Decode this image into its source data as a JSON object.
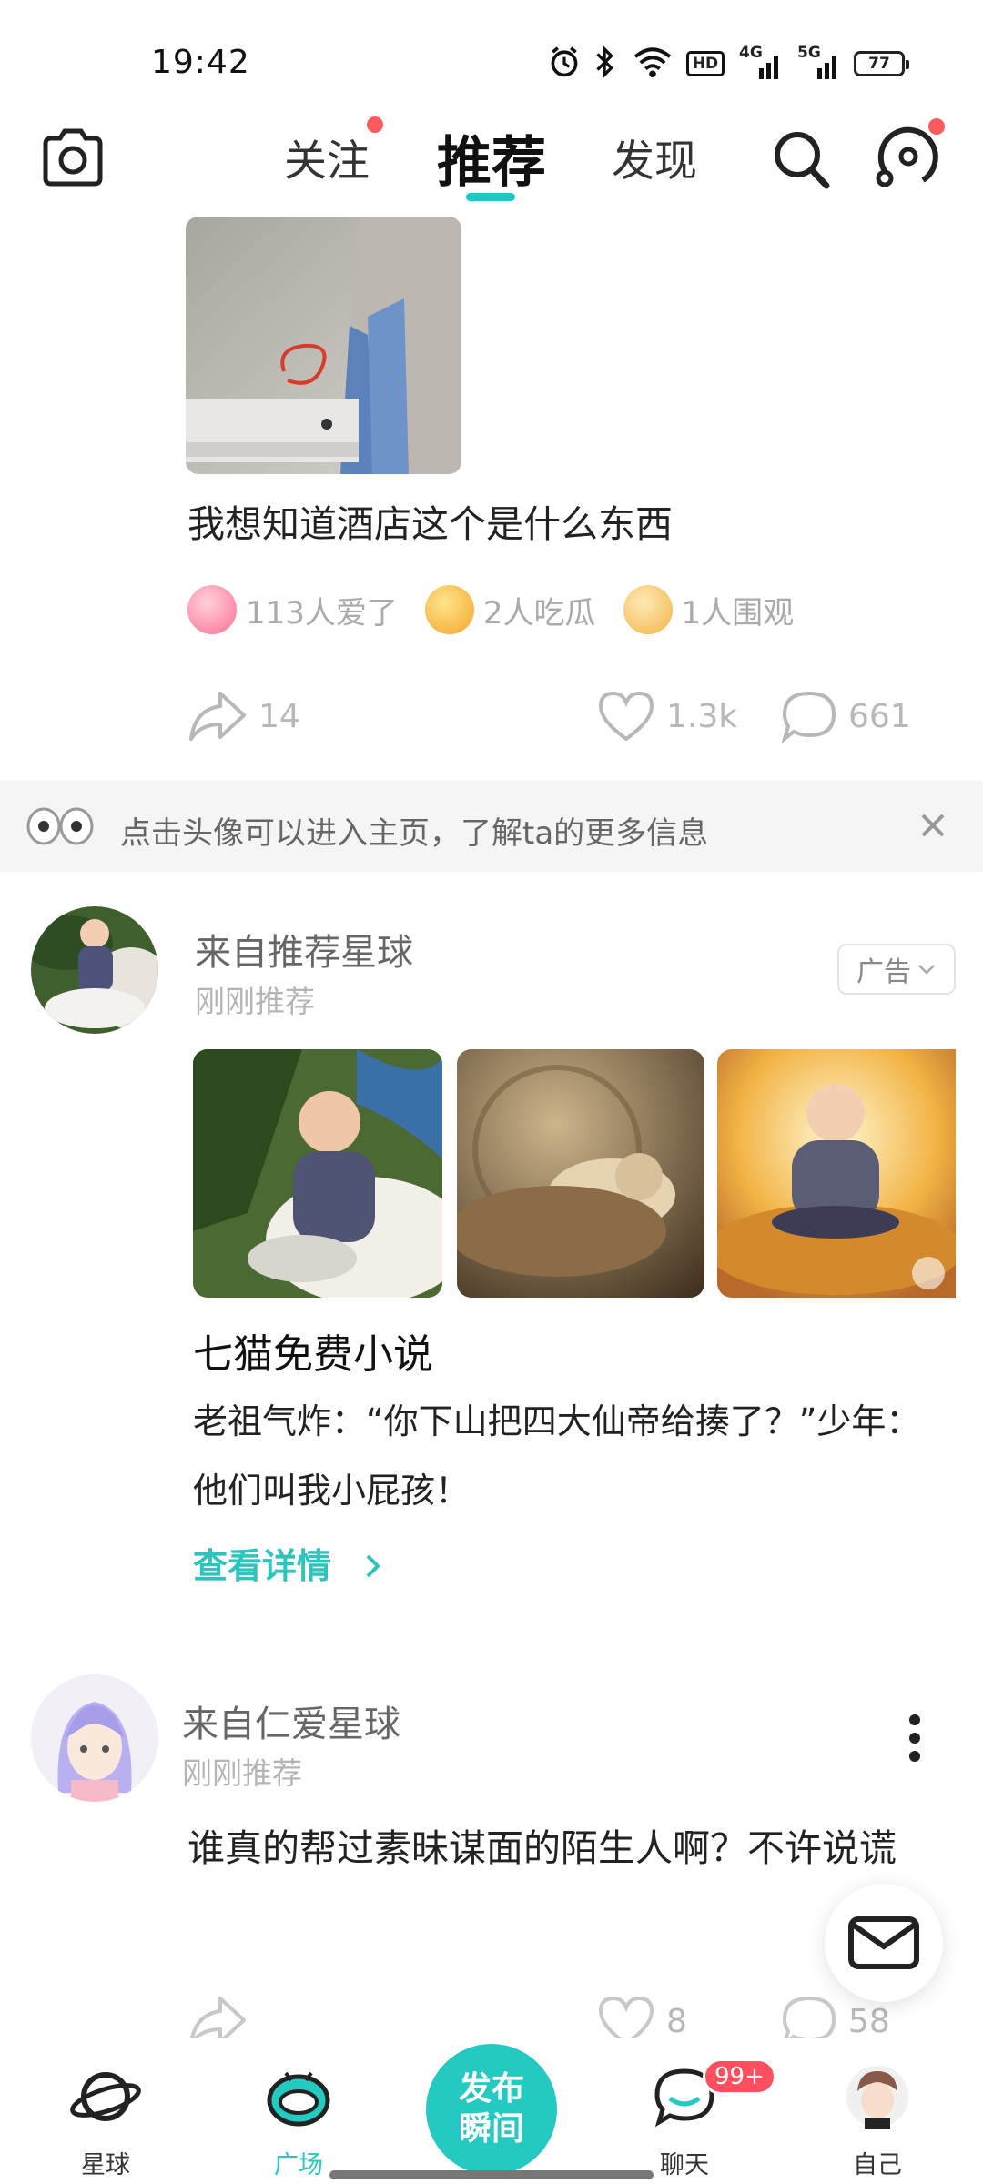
{
  "status_bar": {
    "time": "19:42",
    "network_hd": "HD",
    "network_4g": "4G",
    "network_5g": "5G",
    "battery": "77",
    "icons": [
      "alarm-icon",
      "bluetooth-icon",
      "wifi-icon",
      "signal-icon",
      "signal-icon",
      "battery-icon"
    ]
  },
  "header": {
    "tabs": [
      {
        "label": "关注",
        "active": false,
        "dot": true
      },
      {
        "label": "推荐",
        "active": true,
        "dot": false
      },
      {
        "label": "发现",
        "active": false,
        "dot": false
      }
    ],
    "accent_color": "#1fc8c0"
  },
  "post1": {
    "text": "我想知道酒店这个是什么东西",
    "reactions": [
      {
        "icon": "heart-eyes-emoji-icon",
        "label": "113人爱了"
      },
      {
        "icon": "eating-emoji-icon",
        "label": "2人吃瓜"
      },
      {
        "icon": "dog-emoji-icon",
        "label": "1人围观"
      }
    ],
    "shares": "14",
    "likes": "1.3k",
    "comments": "661"
  },
  "tip": {
    "text": "点击头像可以进入主页，了解ta的更多信息"
  },
  "ad_post": {
    "source": "来自推荐星球",
    "time": "刚刚推荐",
    "badge": "广告",
    "title": "七猫免费小说",
    "description": "老祖气炸：“你下山把四大仙帝给揍了？”少年：他们叫我小屁孩！",
    "link": "查看详情"
  },
  "post2": {
    "source": "来自仁爱星球",
    "time": "刚刚推荐",
    "text": "谁真的帮过素昧谋面的陌生人啊？不许说谎",
    "likes": "8",
    "comments": "58"
  },
  "bottom_nav": {
    "items": [
      {
        "label": "星球",
        "icon": "planet-icon"
      },
      {
        "label": "广场",
        "icon": "square-icon",
        "active": true
      },
      {
        "label": "聊天",
        "icon": "chat-icon",
        "badge": "99+"
      },
      {
        "label": "自己",
        "icon": "avatar-icon"
      }
    ],
    "publish_label": "发布\n瞬间",
    "publish_line1": "发布",
    "publish_line2": "瞬间",
    "active_color": "#24c9c1"
  }
}
